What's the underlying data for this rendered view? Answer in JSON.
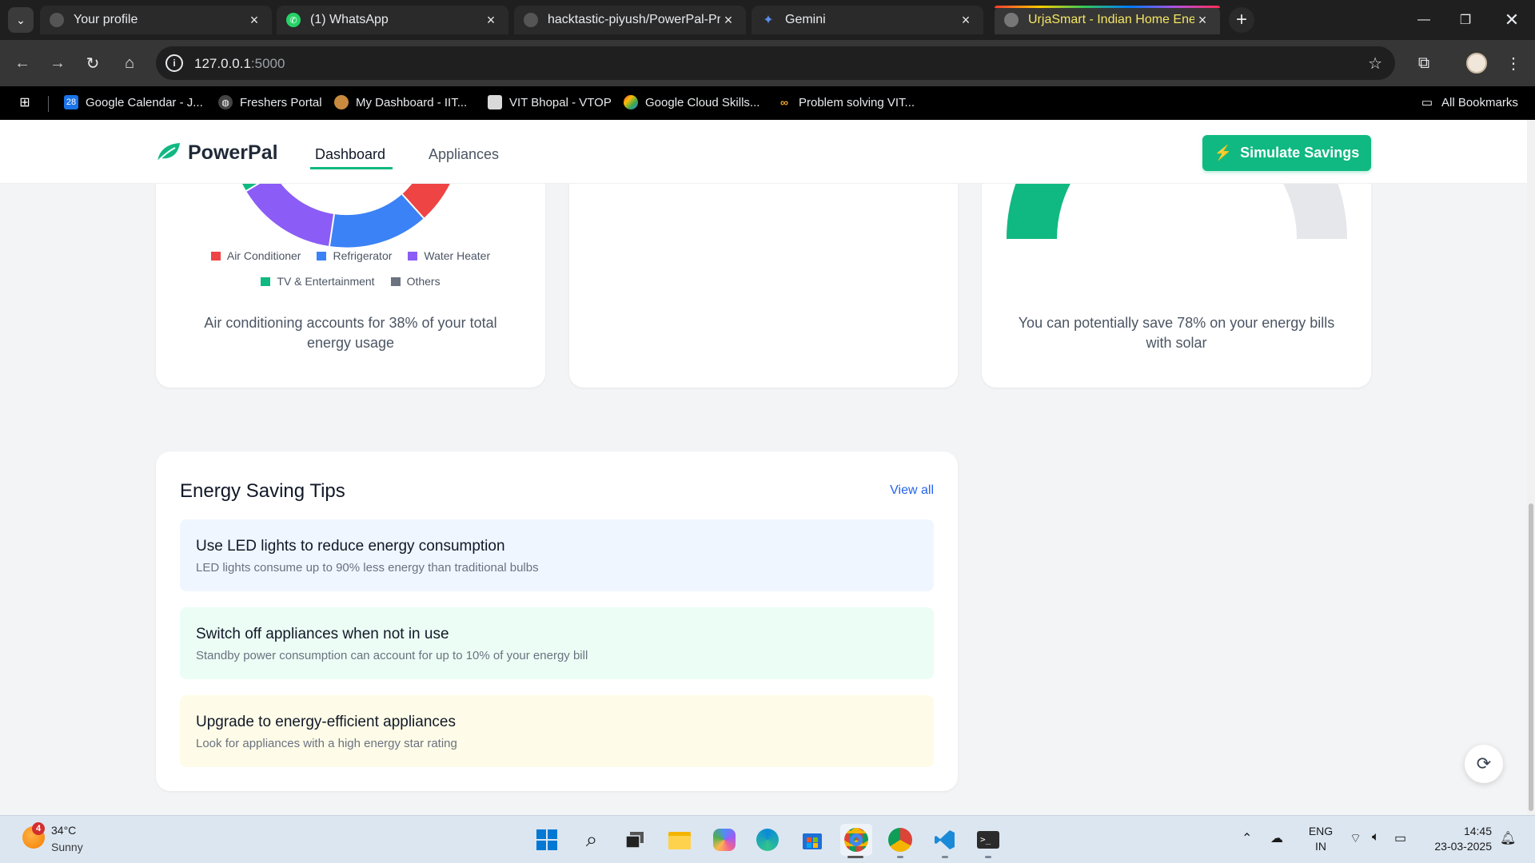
{
  "browser": {
    "tabs": [
      {
        "title": "Your profile",
        "icon": "github-icon"
      },
      {
        "title": "(1) WhatsApp",
        "icon": "whatsapp-icon"
      },
      {
        "title": "hacktastic-piyush/PowerPal-Pro",
        "icon": "github-icon"
      },
      {
        "title": "Gemini",
        "icon": "gemini-icon"
      },
      {
        "title": "UrjaSmart - Indian Home Energ",
        "icon": "globe-icon",
        "active": true
      }
    ],
    "url_host": "127.0.0.1",
    "url_port": ":5000",
    "bookmarks": [
      {
        "label": "Google Calendar - J...",
        "icon": "calendar-icon"
      },
      {
        "label": "Freshers Portal",
        "icon": "globe-icon"
      },
      {
        "label": "My Dashboard - IIT...",
        "icon": "dashboard-icon"
      },
      {
        "label": "VIT Bhopal - VTOP",
        "icon": "vtop-icon"
      },
      {
        "label": "Google Cloud Skills...",
        "icon": "google-cloud-icon"
      },
      {
        "label": "Problem solving VIT...",
        "icon": "coursera-icon"
      }
    ],
    "all_bookmarks_label": "All Bookmarks"
  },
  "app": {
    "brand": "PowerPal",
    "nav": {
      "dashboard": "Dashboard",
      "appliances": "Appliances"
    },
    "simulate_label": "Simulate Savings",
    "brand_color": "#10b981"
  },
  "usage_card": {
    "legend": [
      {
        "label": "Air Conditioner",
        "color": "#ef4444"
      },
      {
        "label": "Refrigerator",
        "color": "#3b82f6"
      },
      {
        "label": "Water Heater",
        "color": "#8b5cf6"
      },
      {
        "label": "TV & Entertainment",
        "color": "#10b981"
      },
      {
        "label": "Others",
        "color": "#6b7280"
      }
    ],
    "note": "Air conditioning accounts for 38% of your total energy usage"
  },
  "solar_card": {
    "note": "You can potentially save 78% on your energy bills with solar",
    "savings_percent": 78
  },
  "tips": {
    "title": "Energy Saving Tips",
    "view_all": "View all",
    "items": [
      {
        "title": "Use LED lights to reduce energy consumption",
        "desc": "LED lights consume up to 90% less energy than traditional bulbs"
      },
      {
        "title": "Switch off appliances when not in use",
        "desc": "Standby power consumption can account for up to 10% of your energy bill"
      },
      {
        "title": "Upgrade to energy-efficient appliances",
        "desc": "Look for appliances with a high energy star rating"
      }
    ]
  },
  "taskbar": {
    "temp": "34°C",
    "condition": "Sunny",
    "weather_badge": "4",
    "lang_1": "ENG",
    "lang_2": "IN",
    "time": "14:45",
    "date": "23-03-2025"
  }
}
